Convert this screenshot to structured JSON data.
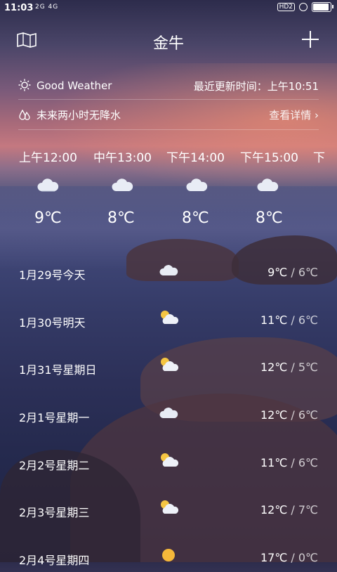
{
  "status_bar": {
    "time": "11:03",
    "signal": "2G 4G",
    "network": "HD2",
    "battery_level": 0.85
  },
  "header": {
    "title": "金牛",
    "map_icon": "map-icon",
    "add_icon": "plus-icon"
  },
  "summary": {
    "weather_label": "Good Weather",
    "weather_icon": "sun-icon",
    "update_time": "最近更新时间：上午10:51",
    "rain_text": "未来两小时无降水",
    "rain_icon": "raindrop-icon",
    "details_link": "查看详情 ›"
  },
  "hourly": [
    {
      "time": "上午12:00",
      "temp": "9℃",
      "icon": "cloud-icon"
    },
    {
      "time": "中午13:00",
      "temp": "8℃",
      "icon": "cloud-icon"
    },
    {
      "time": "下午14:00",
      "temp": "8℃",
      "icon": "cloud-icon"
    },
    {
      "time": "下午15:00",
      "temp": "8℃",
      "icon": "cloud-icon"
    },
    {
      "time": "下",
      "temp": "",
      "icon": ""
    }
  ],
  "daily": [
    {
      "label": "1月29号今天",
      "high": "9℃",
      "low": "/ 6℃",
      "icon": "cloud-icon"
    },
    {
      "label": "1月30号明天",
      "high": "11℃",
      "low": "/ 6℃",
      "icon": "partly-cloudy-icon"
    },
    {
      "label": "1月31号星期日",
      "high": "12℃",
      "low": "/ 5℃",
      "icon": "partly-cloudy-icon"
    },
    {
      "label": "2月1号星期一",
      "high": "12℃",
      "low": "/ 6℃",
      "icon": "cloud-icon"
    },
    {
      "label": "2月2号星期二",
      "high": "11℃",
      "low": "/ 6℃",
      "icon": "partly-cloudy-icon"
    },
    {
      "label": "2月3号星期三",
      "high": "12℃",
      "low": "/ 7℃",
      "icon": "partly-cloudy-icon"
    },
    {
      "label": "2月4号星期四",
      "high": "17℃",
      "low": "/ 0℃",
      "icon": "sun-icon"
    }
  ],
  "colors": {
    "text": "#ffffff",
    "accent_sunset": "#c47880",
    "sea": "#3e4575"
  }
}
